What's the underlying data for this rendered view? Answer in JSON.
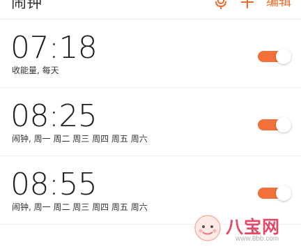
{
  "header": {
    "title": "闹钟",
    "edit_label": "编辑",
    "accent_color": "#f06a2a",
    "icons": [
      "microphone-icon",
      "plus-icon"
    ]
  },
  "alarms": [
    {
      "time": "07:18",
      "subtitle": "收能量, 每天",
      "enabled": true
    },
    {
      "time": "08:25",
      "subtitle": "闹钟, 周一 周二 周三 周四 周五 周六",
      "enabled": true
    },
    {
      "time": "08:55",
      "subtitle": "闹钟, 周一 周二 周三 周四 周五 周六",
      "enabled": true
    }
  ],
  "toggle_color": "#f2703a",
  "watermark": {
    "text": "八宝网",
    "url": "www.8bb.com"
  }
}
